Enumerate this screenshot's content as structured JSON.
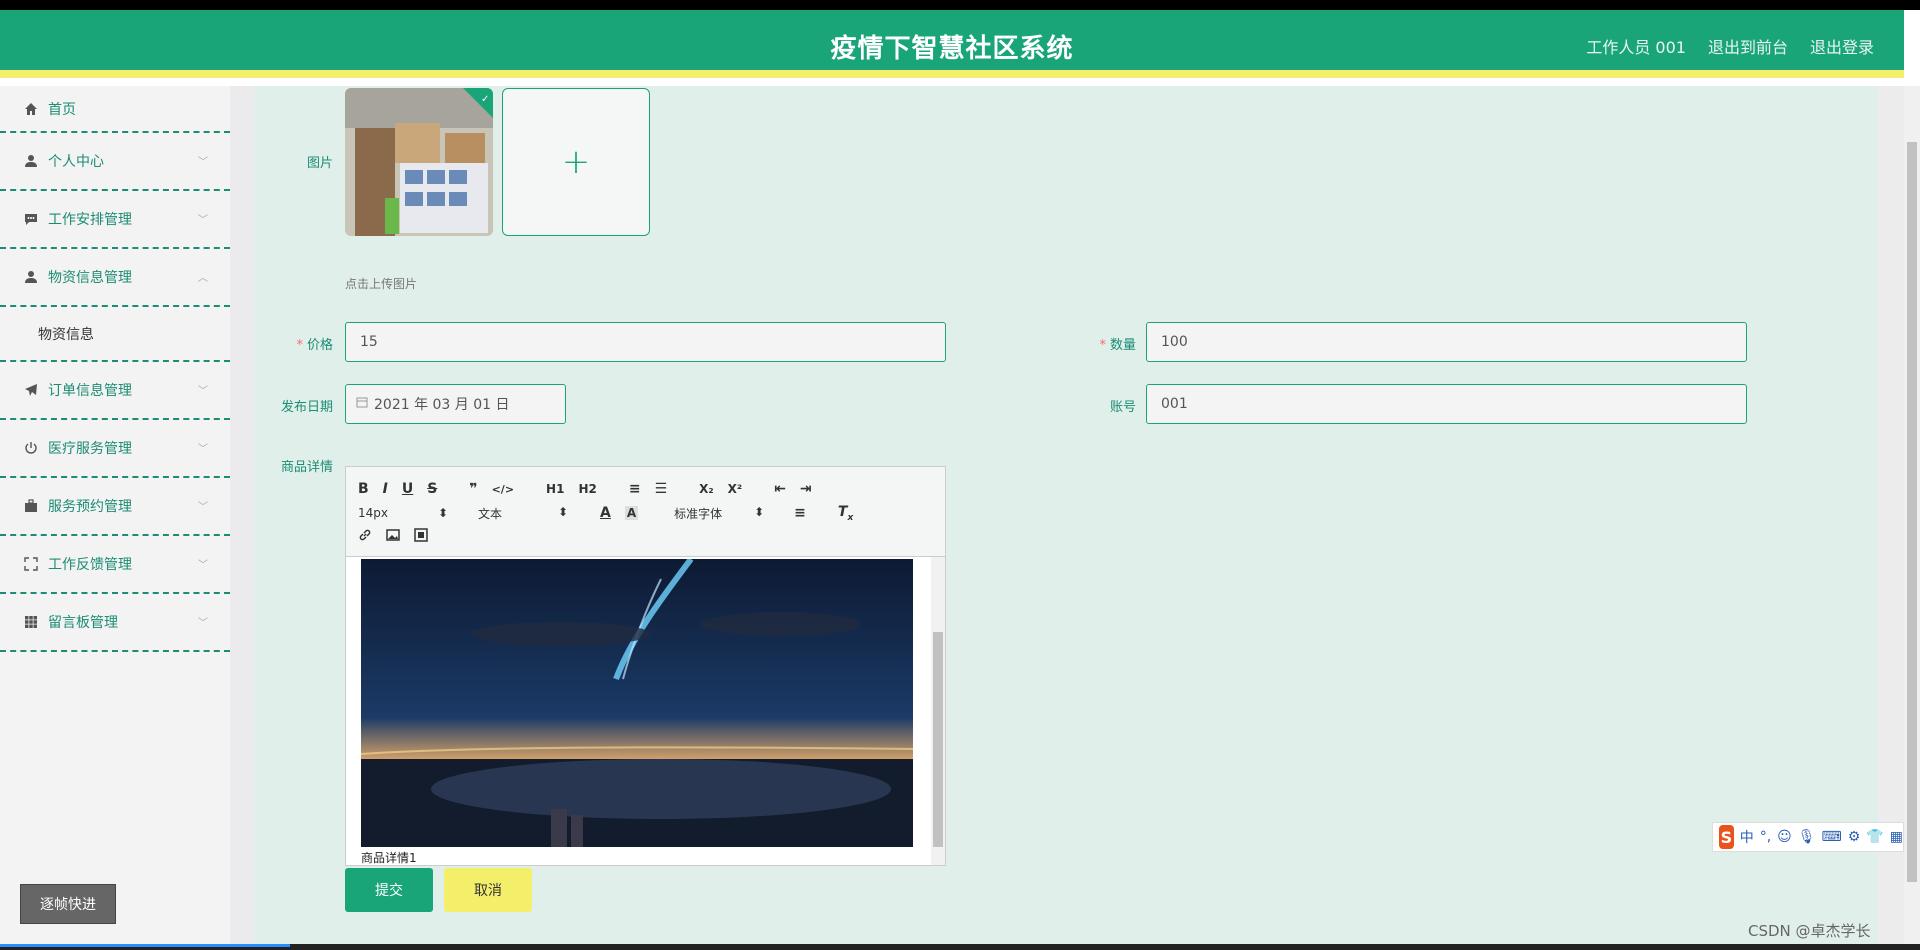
{
  "header": {
    "title": "疫情下智慧社区系统",
    "user_label": "工作人员 001",
    "front_link": "退出到前台",
    "logout_link": "退出登录"
  },
  "sidebar": {
    "items": [
      {
        "label": "首页",
        "icon": "home-icon"
      },
      {
        "label": "个人中心",
        "icon": "user-icon"
      },
      {
        "label": "工作安排管理",
        "icon": "chat-icon"
      },
      {
        "label": "物资信息管理",
        "icon": "user-icon"
      },
      {
        "label": "订单信息管理",
        "icon": "send-icon"
      },
      {
        "label": "医疗服务管理",
        "icon": "power-icon"
      },
      {
        "label": "服务预约管理",
        "icon": "briefcase-icon"
      },
      {
        "label": "工作反馈管理",
        "icon": "fullscreen-icon"
      },
      {
        "label": "留言板管理",
        "icon": "grid-icon"
      }
    ],
    "submenu_item": "物资信息",
    "bottom_button": "逐帧快进"
  },
  "form": {
    "image_label": "图片",
    "upload_hint": "点击上传图片",
    "upload_add": "+",
    "price_label": "价格",
    "price_value": "15",
    "quantity_label": "数量",
    "quantity_value": "100",
    "date_label": "发布日期",
    "date_value": "2021 年 03 月 01 日",
    "account_label": "账号",
    "account_value": "001",
    "detail_label": "商品详情",
    "required_mark": "*",
    "submit": "提交",
    "cancel": "取消"
  },
  "editor": {
    "toolbar_row1": [
      "B",
      "I",
      "U",
      "S",
      "❞",
      "</>",
      "H1",
      "H2",
      "≡",
      "☰",
      "X₂",
      "X²",
      "⇤",
      "⇥"
    ],
    "font_size": "14px",
    "text_type": "文本",
    "font_family": "标准字体",
    "caption": "商品详情1"
  },
  "ime": {
    "logo": "S",
    "lang": "中",
    "punct": "°,"
  },
  "watermark": "CSDN @卓杰学长",
  "colors": {
    "primary": "#1aa579",
    "accent_yellow": "#f4ef6a",
    "main_bg": "#e1efeb"
  }
}
